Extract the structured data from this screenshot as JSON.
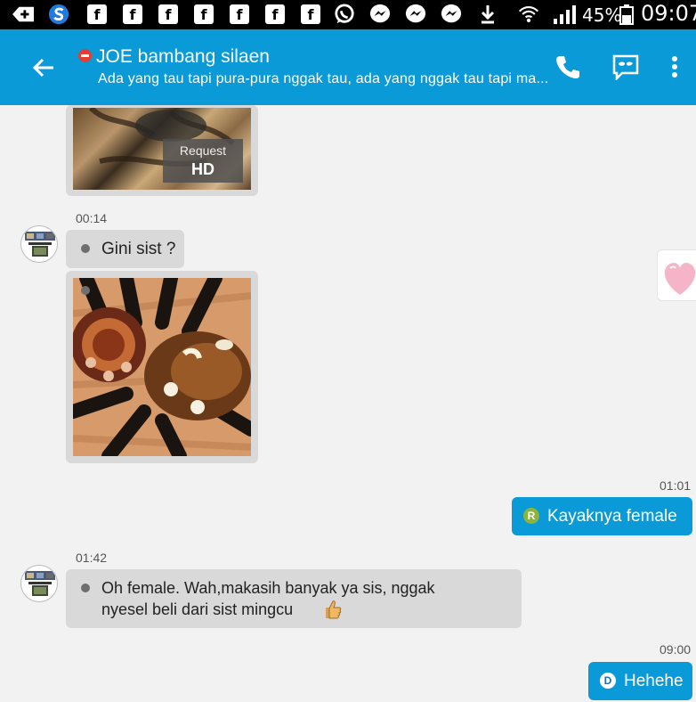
{
  "status_bar": {
    "battery": "45%",
    "clock": "09:07"
  },
  "header": {
    "title": "JOE bambang silaen",
    "subtitle": "Ada yang tau tapi pura-pura nggak tau, ada yang nggak tau tapi ma..."
  },
  "messages": {
    "hd_request_label": "Request",
    "hd_label": "HD",
    "m1_time": "00:14",
    "m1_text": "Gini sist ?",
    "m2_time": "01:01",
    "m2_badge": "R",
    "m2_text": "Kayaknya female",
    "m3_time": "01:42",
    "m3_line1": "Oh female. Wah,makasih banyak ya sis, nggak",
    "m3_line2": "nyesel beli dari sist mingcu",
    "m4_time": "09:00",
    "m4_badge": "D",
    "m4_text": "Hehehe"
  },
  "colors": {
    "accent": "#0b9ad8",
    "bubble_in": "#d9d9d9",
    "badge_r": "#8cb43c",
    "badge_d": "#1a6fb5"
  },
  "icons": [
    "back-arrow-icon",
    "phone-icon",
    "secret-chat-icon",
    "overflow-menu-icon",
    "heart-sticker-icon",
    "thumbs-up-emoji-icon"
  ]
}
